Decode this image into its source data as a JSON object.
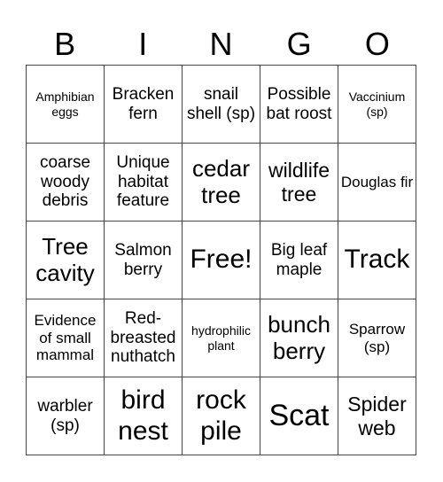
{
  "header": {
    "letters": [
      "B",
      "I",
      "N",
      "G",
      "O"
    ]
  },
  "cells": [
    [
      {
        "text": "Amphibian eggs",
        "size": "xs"
      },
      {
        "text": "Bracken fern",
        "size": "m"
      },
      {
        "text": "snail shell (sp)",
        "size": "m"
      },
      {
        "text": "Possible bat roost",
        "size": "m"
      },
      {
        "text": "Vaccinium (sp)",
        "size": "xs"
      }
    ],
    [
      {
        "text": "coarse woody debris",
        "size": "m"
      },
      {
        "text": "Unique habitat feature",
        "size": "m"
      },
      {
        "text": "cedar tree",
        "size": "l"
      },
      {
        "text": "wildlife tree",
        "size": "l_small"
      },
      {
        "text": "Douglas fir",
        "size": "s"
      }
    ],
    [
      {
        "text": "Tree cavity",
        "size": "l"
      },
      {
        "text": "Salmon berry",
        "size": "m"
      },
      {
        "text": "Free!",
        "size": "xl"
      },
      {
        "text": "Big leaf maple",
        "size": "m"
      },
      {
        "text": "Track",
        "size": "xl"
      }
    ],
    [
      {
        "text": "Evidence of small mammal",
        "size": "s"
      },
      {
        "text": "Red-breasted nuthatch",
        "size": "m"
      },
      {
        "text": "hydrophilic plant",
        "size": "xs"
      },
      {
        "text": "bunch berry",
        "size": "l"
      },
      {
        "text": "Sparrow (sp)",
        "size": "s"
      }
    ],
    [
      {
        "text": "warbler (sp)",
        "size": "m"
      },
      {
        "text": "bird nest",
        "size": "xl"
      },
      {
        "text": "rock pile",
        "size": "xl"
      },
      {
        "text": "Scat",
        "size": "xxl"
      },
      {
        "text": "Spider web",
        "size": "l_small"
      }
    ]
  ]
}
